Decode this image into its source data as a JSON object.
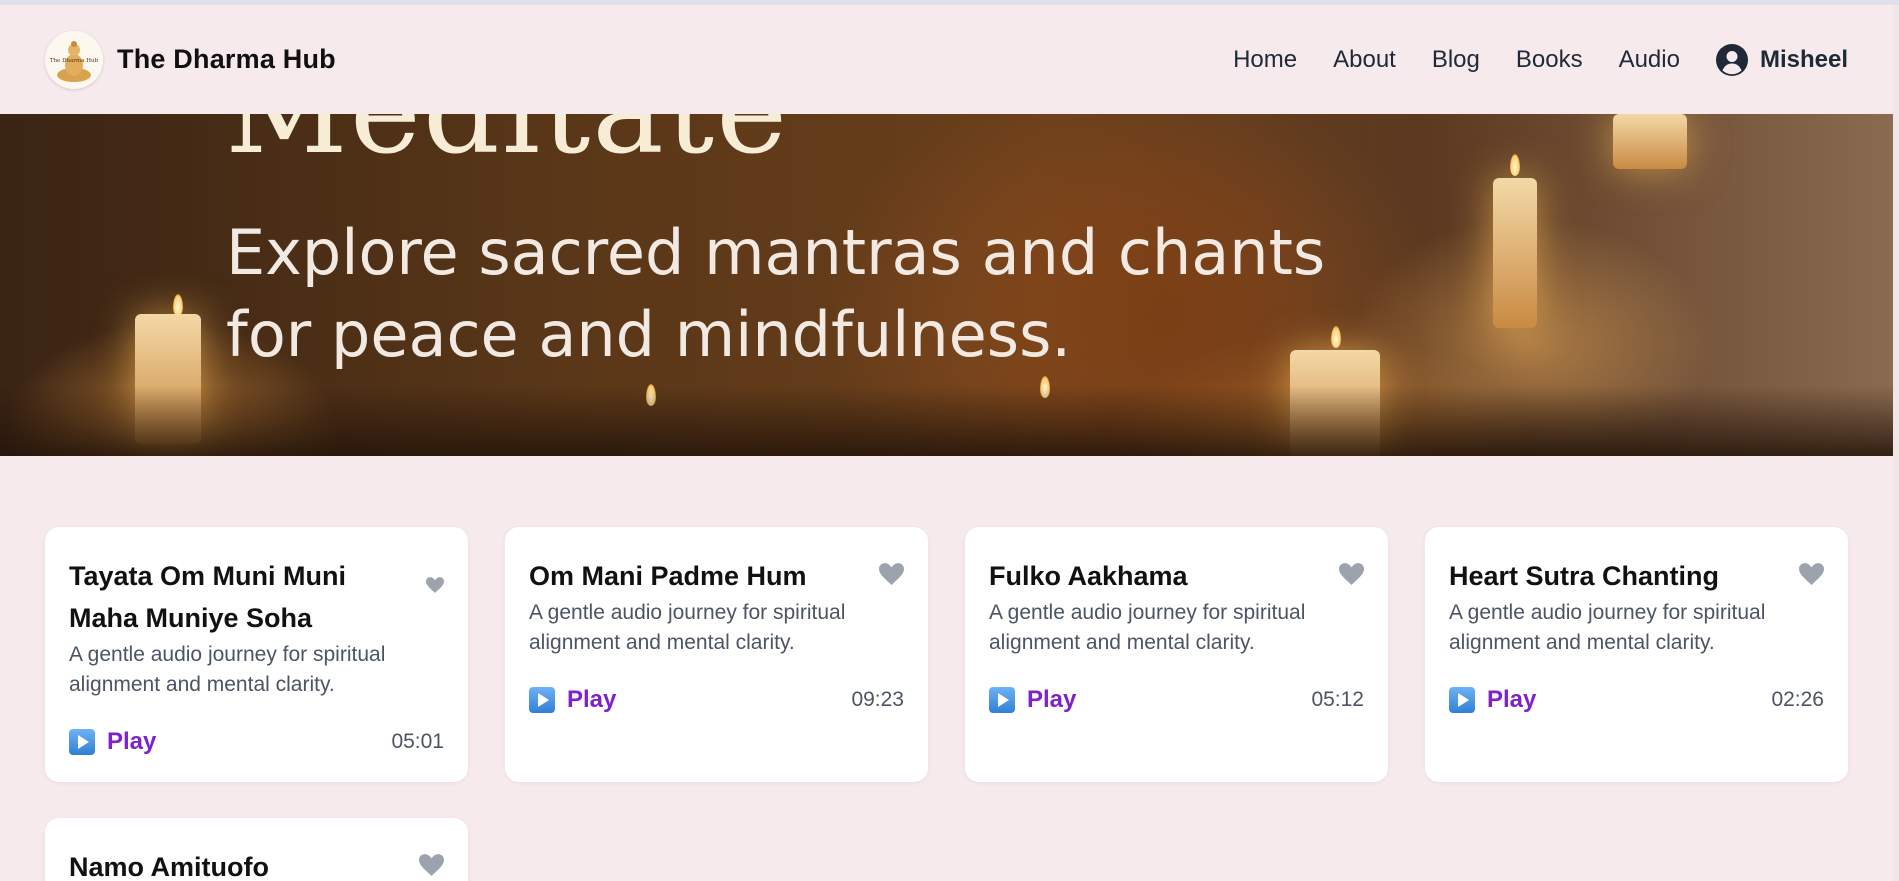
{
  "brand": {
    "name": "The Dharma Hub",
    "logo_text": "The Dharma Hub"
  },
  "nav": {
    "items": [
      {
        "label": "Home"
      },
      {
        "label": "About"
      },
      {
        "label": "Blog"
      },
      {
        "label": "Books"
      },
      {
        "label": "Audio"
      }
    ],
    "user": {
      "name": "Misheel",
      "icon": "user-circle-icon"
    }
  },
  "hero": {
    "title": "Meditate",
    "subtitle_line1": "Explore sacred mantras and chants",
    "subtitle_line2": "for peace and mindfulness."
  },
  "cards": [
    {
      "title": "Tayata Om Muni Muni Maha Muniye Soha",
      "description": "A gentle audio journey for spiritual alignment and mental clarity.",
      "play_label": "Play",
      "duration": "05:01"
    },
    {
      "title": "Om Mani Padme Hum",
      "description": "A gentle audio journey for spiritual alignment and mental clarity.",
      "play_label": "Play",
      "duration": "09:23"
    },
    {
      "title": "Fulko Aakhama",
      "description": "A gentle audio journey for spiritual alignment and mental clarity.",
      "play_label": "Play",
      "duration": "05:12"
    },
    {
      "title": "Heart Sutra Chanting",
      "description": "A gentle audio journey for spiritual alignment and mental clarity.",
      "play_label": "Play",
      "duration": "02:26"
    },
    {
      "title": "Namo Amituofo"
    }
  ],
  "colors": {
    "accent": "#7e22ce",
    "background": "#f6eaec",
    "heart": "#9ca3af"
  }
}
